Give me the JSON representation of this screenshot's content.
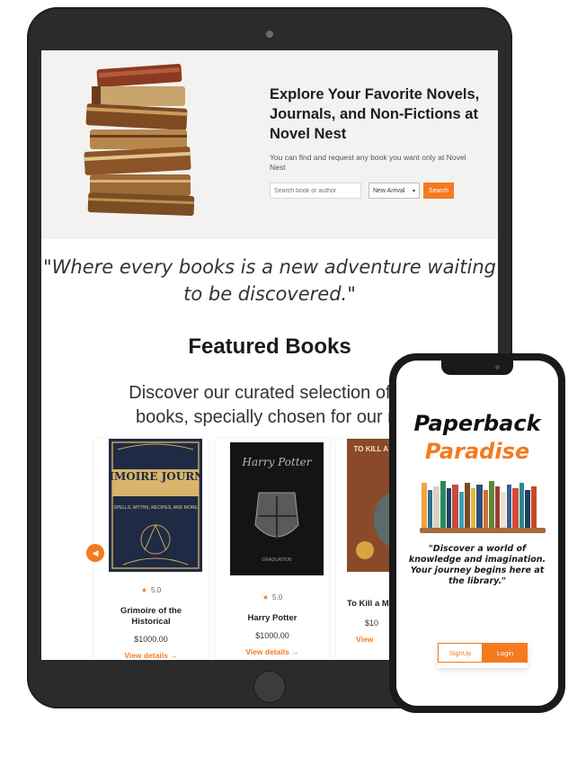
{
  "tablet": {
    "hero": {
      "title": "Explore Your Favorite Novels, Journals, and Non-Fictions at Novel Nest",
      "subtitle": "You can find and request any book you want only at Novel Nest",
      "search_placeholder": "Search book or author",
      "filter_value": "New Arrival",
      "search_label": "Search"
    },
    "quote": "\"Where every books is a new adventure waiting to be discovered.\"",
    "featured": {
      "title": "Featured Books",
      "subtitle_line1": "Discover our curated selection of m",
      "subtitle_line2": "books, specially chosen for our re",
      "prev_icon": "chevron-left-icon",
      "books": [
        {
          "cover_title": "GRIMOIRE JOURNAL",
          "cover_sub": "SPELLS, MYTHS, RECIPES, AND MORE",
          "rating": "5.0",
          "title": "Grimoire of the Historical",
          "price": "$1000.00",
          "link": "View details →"
        },
        {
          "cover_title": "Harry Potter",
          "cover_sub": "GRADUATION",
          "rating": "5.0",
          "title": "Harry Potter",
          "price": "$1000.00",
          "link": "View details →"
        },
        {
          "cover_title": "TO KILL A MOCK",
          "cover_sub": "",
          "rating": "",
          "title": "To Kill a M",
          "price": "$10",
          "link": "View"
        }
      ]
    }
  },
  "phone": {
    "app_name_line1": "Paperback",
    "app_name_line2": "Paradise",
    "quote": "\"Discover a world of knowledge and imagination. Your journey begins here at the library.\"",
    "signup_label": "SignUp",
    "login_label": "Login"
  },
  "colors": {
    "accent": "#f47a20",
    "device_frame": "#2b2b2b",
    "hero_bg": "#f3f2f0"
  }
}
